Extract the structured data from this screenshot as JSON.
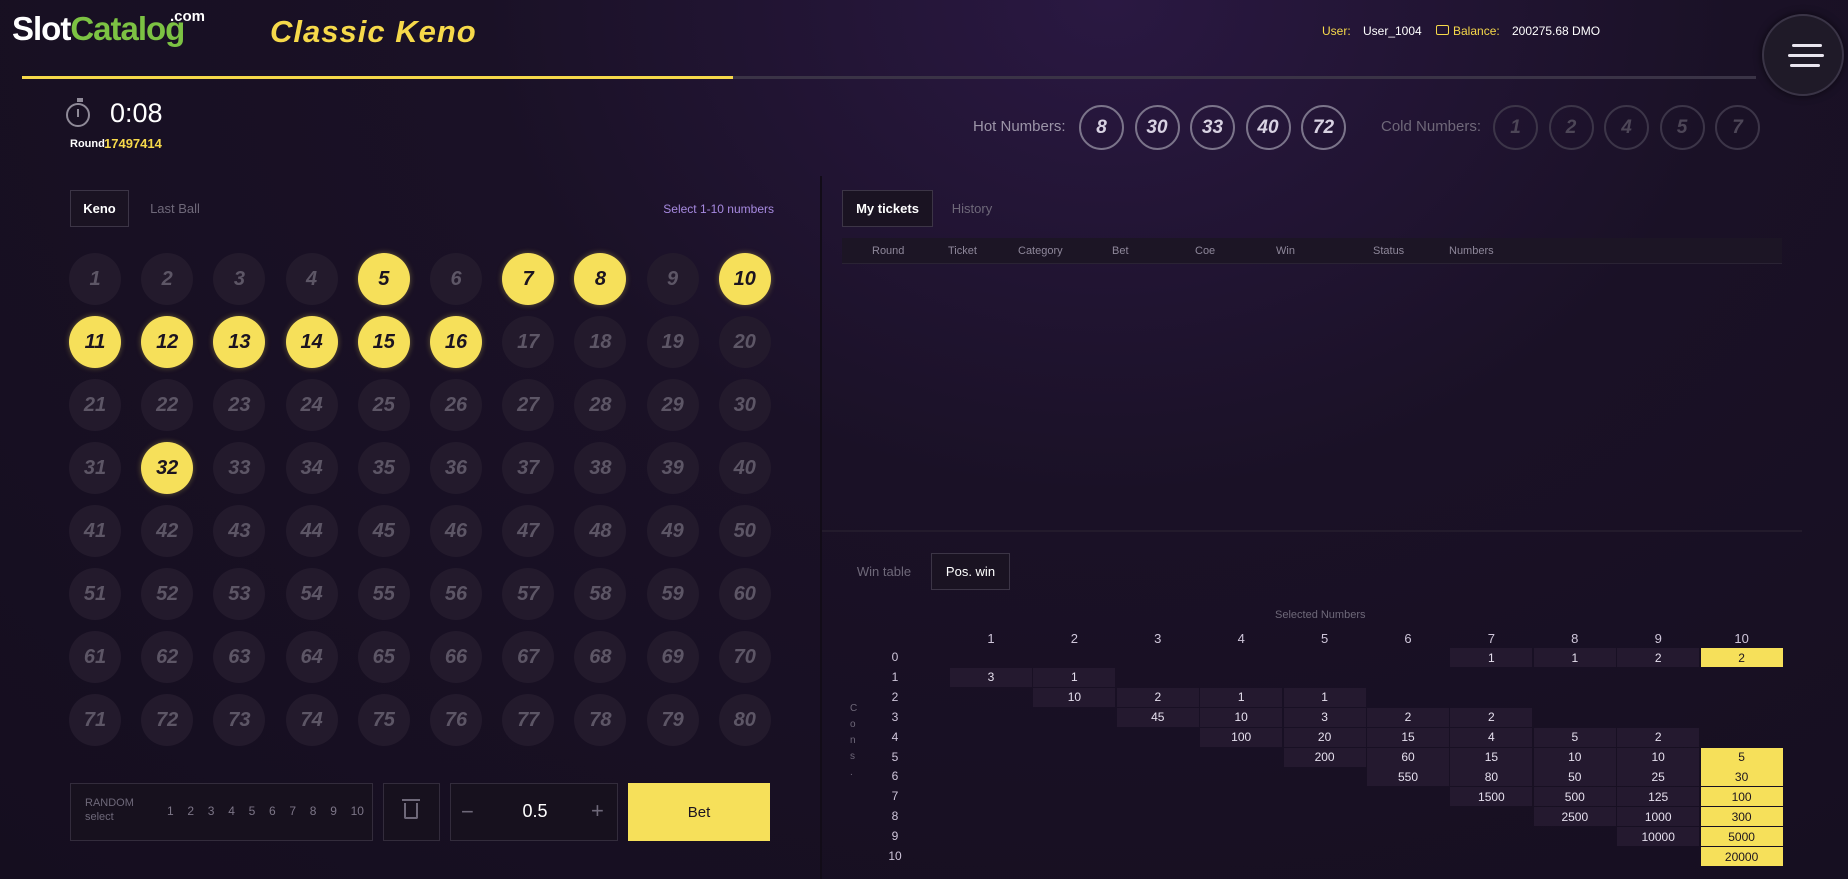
{
  "header": {
    "logo_slot": "Slot",
    "logo_catalog": "Catalog",
    "logo_com": ".com",
    "game_title": "Classic Keno",
    "user_label": "User:",
    "user_value": "User_1004",
    "balance_label": "Balance:",
    "balance_value": "200275.68 DMO",
    "round_progress": 0.41
  },
  "timer": {
    "time": "0:08",
    "round_label": "Round",
    "round_value": "17497414"
  },
  "hot": {
    "label": "Hot Numbers:",
    "numbers": [
      "8",
      "30",
      "33",
      "40",
      "72"
    ]
  },
  "cold": {
    "label": "Cold Numbers:",
    "numbers": [
      "1",
      "2",
      "4",
      "5",
      "7"
    ]
  },
  "left": {
    "tab_keno": "Keno",
    "tab_last_ball": "Last Ball",
    "hint": "Select 1-10 numbers",
    "selected": [
      5,
      7,
      8,
      10,
      11,
      12,
      13,
      14,
      15,
      16,
      32
    ],
    "random_title": "RANDOM",
    "random_sub": "select",
    "random_numbers": [
      "1",
      "2",
      "3",
      "4",
      "5",
      "6",
      "7",
      "8",
      "9",
      "10"
    ],
    "minus": "−",
    "plus": "+",
    "bet_amount": "0.5",
    "bet_label": "Bet"
  },
  "tickets": {
    "tab_my": "My tickets",
    "tab_history": "History",
    "columns": [
      "Round",
      "Ticket",
      "Category",
      "Bet",
      "Coe",
      "Win",
      "Status",
      "Numbers"
    ]
  },
  "wintable": {
    "tab_win": "Win table",
    "tab_pos": "Pos. win",
    "selected_title": "Selected Numbers",
    "cons_label": "C o n s .",
    "col_headers": [
      "1",
      "2",
      "3",
      "4",
      "5",
      "6",
      "7",
      "8",
      "9",
      "10"
    ],
    "row_headers": [
      "0",
      "1",
      "2",
      "3",
      "4",
      "5",
      "6",
      "7",
      "8",
      "9",
      "10"
    ],
    "rows": [
      [
        "",
        "",
        "",
        "",
        "",
        "",
        "1",
        "1",
        "2",
        "2"
      ],
      [
        "3",
        "1",
        "",
        "",
        "",
        "",
        "",
        "",
        "",
        ""
      ],
      [
        "",
        "10",
        "2",
        "1",
        "1",
        "",
        "",
        "",
        "",
        ""
      ],
      [
        "",
        "",
        "45",
        "10",
        "3",
        "2",
        "2",
        "",
        "",
        ""
      ],
      [
        "",
        "",
        "",
        "100",
        "20",
        "15",
        "4",
        "5",
        "2",
        ""
      ],
      [
        "",
        "",
        "",
        "",
        "200",
        "60",
        "15",
        "10",
        "10",
        "5"
      ],
      [
        "",
        "",
        "",
        "",
        "",
        "550",
        "80",
        "50",
        "25",
        "30"
      ],
      [
        "",
        "",
        "",
        "",
        "",
        "",
        "1500",
        "500",
        "125",
        "100"
      ],
      [
        "",
        "",
        "",
        "",
        "",
        "",
        "",
        "2500",
        "1000",
        "300"
      ],
      [
        "",
        "",
        "",
        "",
        "",
        "",
        "",
        "",
        "10000",
        "5000"
      ],
      [
        "",
        "",
        "",
        "",
        "",
        "",
        "",
        "",
        "",
        "20000"
      ]
    ],
    "highlight_col": 10,
    "highlight_rows": [
      0,
      5,
      6,
      7,
      8,
      9,
      10
    ]
  },
  "colors": {
    "accent": "#f6e05a",
    "logo_green": "#7cc243",
    "link": "#a78ae0"
  }
}
